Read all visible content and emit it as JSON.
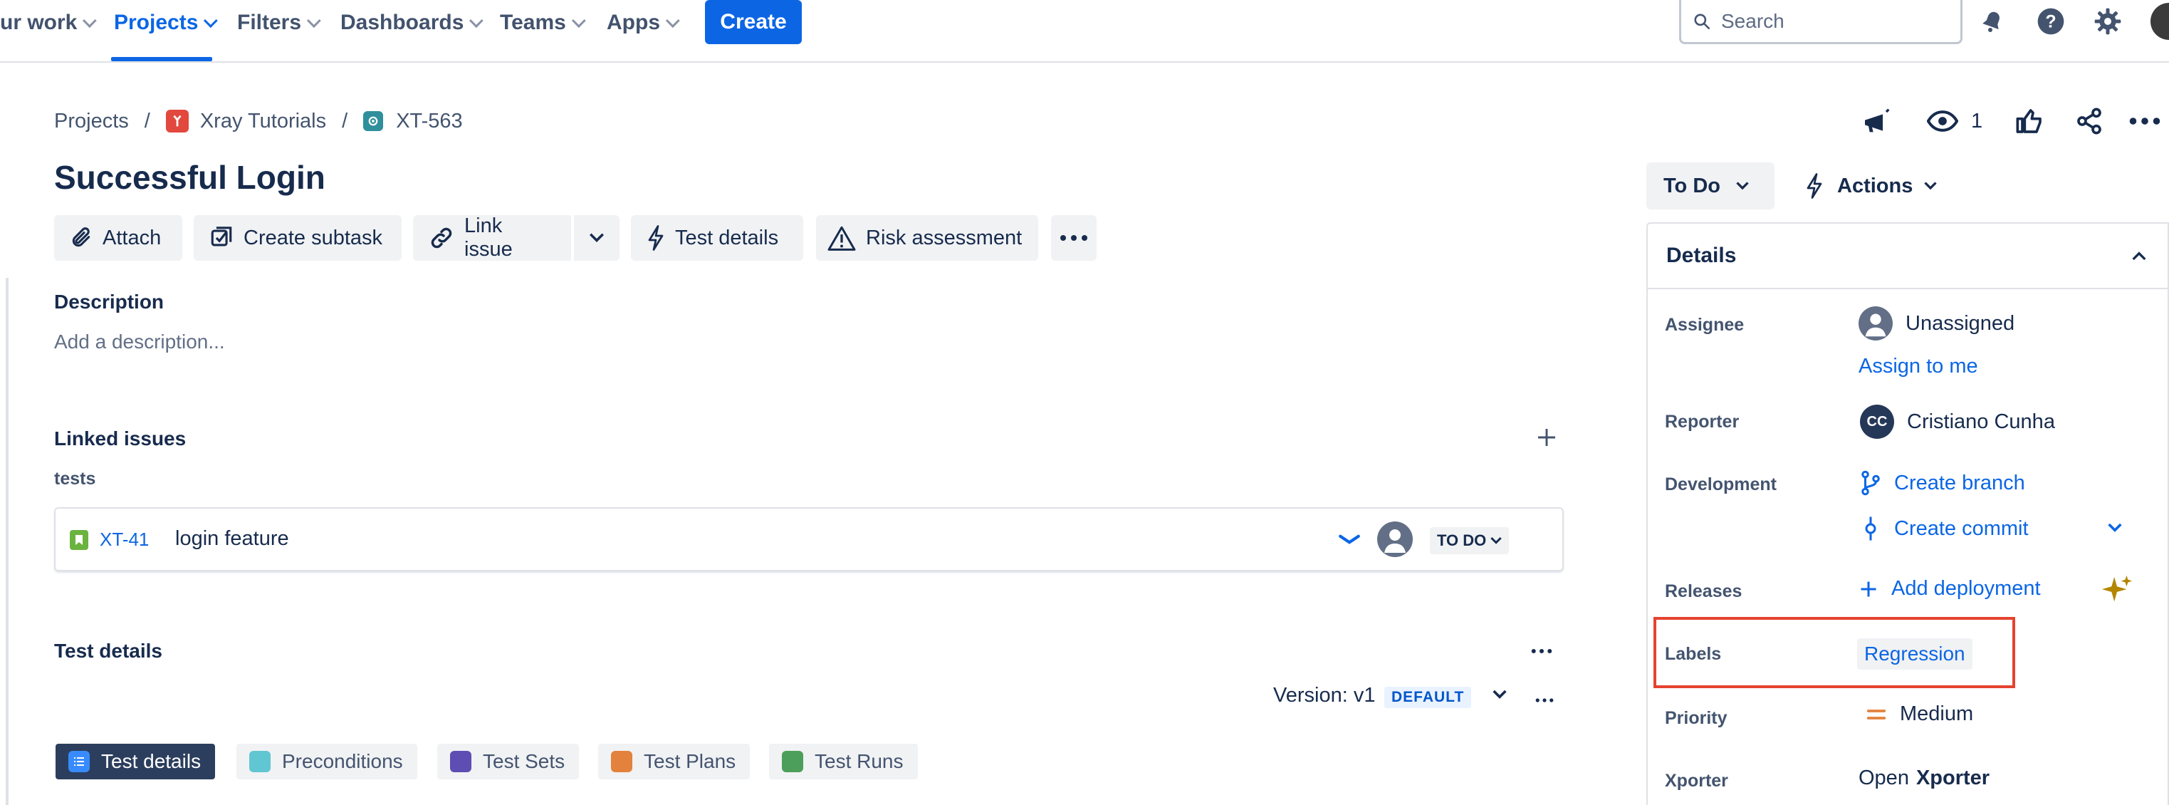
{
  "nav": {
    "your_work": "ur work",
    "projects": "Projects",
    "filters": "Filters",
    "dashboards": "Dashboards",
    "teams": "Teams",
    "apps": "Apps",
    "create": "Create",
    "search_placeholder": "Search"
  },
  "breadcrumb": {
    "root": "Projects",
    "project": "Xray Tutorials",
    "issue_key": "XT-563"
  },
  "issue": {
    "title": "Successful Login",
    "watchers": "1"
  },
  "toolbar": {
    "attach": "Attach",
    "create_subtask": "Create subtask",
    "link_issue": "Link issue",
    "test_details": "Test details",
    "risk_assessment": "Risk assessment"
  },
  "description": {
    "heading": "Description",
    "placeholder": "Add a description..."
  },
  "linked_issues": {
    "heading": "Linked issues",
    "relation": "tests",
    "items": [
      {
        "key": "XT-41",
        "summary": "login feature",
        "status": "TO DO"
      }
    ]
  },
  "test_details": {
    "heading": "Test details",
    "version": "Version: v1",
    "default_badge": "DEFAULT",
    "tabs": [
      "Test details",
      "Preconditions",
      "Test Sets",
      "Test Plans",
      "Test Runs"
    ]
  },
  "sidebar": {
    "status": "To Do",
    "actions": "Actions",
    "details_heading": "Details",
    "fields": {
      "assignee_label": "Assignee",
      "assignee_value": "Unassigned",
      "assign_to_me": "Assign to me",
      "reporter_label": "Reporter",
      "reporter_initials": "CC",
      "reporter_value": "Cristiano Cunha",
      "development_label": "Development",
      "create_branch": "Create branch",
      "create_commit": "Create commit",
      "releases_label": "Releases",
      "add_deployment": "Add deployment",
      "labels_label": "Labels",
      "labels_value": "Regression",
      "priority_label": "Priority",
      "priority_value": "Medium",
      "xporter_label": "Xporter",
      "xporter_open": "Open",
      "xporter_name": "Xporter"
    }
  },
  "colors": {
    "primary": "#0c66e4",
    "text": "#172b4d",
    "highlight": "#e5432f",
    "nav_active_tab": "#2c3e5d"
  }
}
